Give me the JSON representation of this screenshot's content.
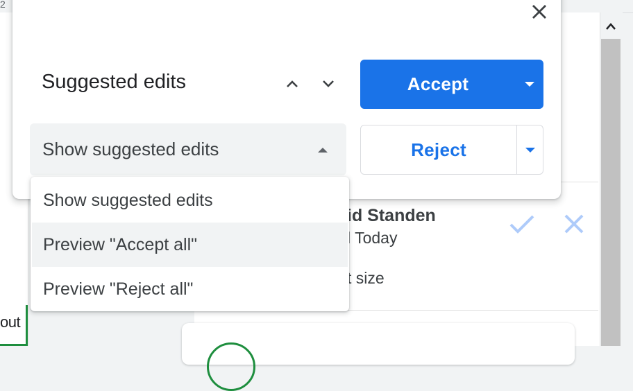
{
  "background": {
    "ruler_number": "2",
    "doc_fragment": "out",
    "comment": {
      "author_fragment": "id Standen",
      "time_fragment": "l Today",
      "text_fragment": "t size"
    },
    "icons": [
      "check-icon",
      "close-icon"
    ]
  },
  "dialog": {
    "title": "Suggested edits",
    "close_icon": "close-icon",
    "nav": {
      "previous_icon": "chevron-up-icon",
      "next_icon": "chevron-down-icon"
    },
    "accept": {
      "label": "Accept",
      "caret_icon": "caret-down-icon"
    },
    "reject": {
      "label": "Reject",
      "caret_icon": "caret-down-icon"
    },
    "view_select": {
      "value": "Show suggested edits",
      "caret_icon": "caret-up-icon"
    }
  },
  "menu": {
    "items": [
      {
        "label": "Show suggested edits"
      },
      {
        "label": "Preview \"Accept all\"",
        "highlighted": true
      },
      {
        "label": "Preview \"Reject all\""
      }
    ]
  },
  "colors": {
    "accent": "#1a73e8",
    "muted_icon": "#aecbfa",
    "text": "#202124",
    "select_bg": "#f1f3f4"
  }
}
